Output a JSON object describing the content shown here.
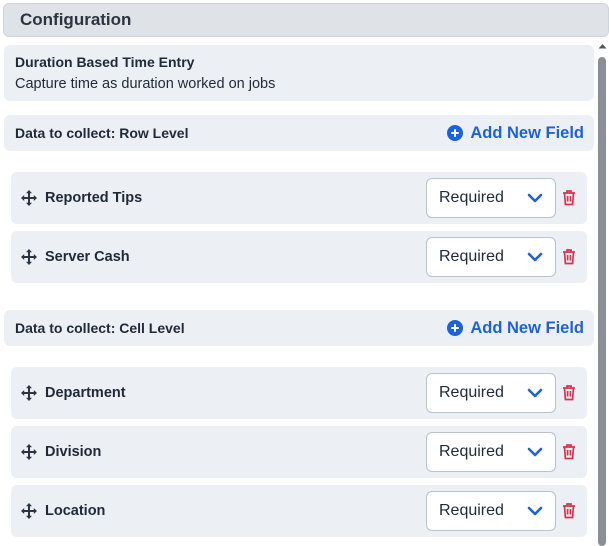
{
  "panel": {
    "title": "Configuration"
  },
  "info": {
    "title": "Duration Based Time Entry",
    "subtitle": "Capture time as duration worked on jobs"
  },
  "row_section": {
    "title": "Data to collect: Row Level",
    "add_label": "Add New Field",
    "fields": [
      {
        "label": "Reported Tips",
        "requirement": "Required"
      },
      {
        "label": "Server Cash",
        "requirement": "Required"
      }
    ]
  },
  "cell_section": {
    "title": "Data to collect: Cell Level",
    "add_label": "Add New Field",
    "fields": [
      {
        "label": "Department",
        "requirement": "Required"
      },
      {
        "label": "Division",
        "requirement": "Required"
      },
      {
        "label": "Location",
        "requirement": "Required"
      }
    ]
  },
  "colors": {
    "accent": "#1d62d8",
    "delete": "#d9344e",
    "card_bg": "#eceff4",
    "header_bg": "#dfe3e8"
  },
  "icons": {
    "add": "plus-circle-icon",
    "drag": "move-icon",
    "dropdown": "chevron-down-icon",
    "delete": "trash-icon"
  }
}
